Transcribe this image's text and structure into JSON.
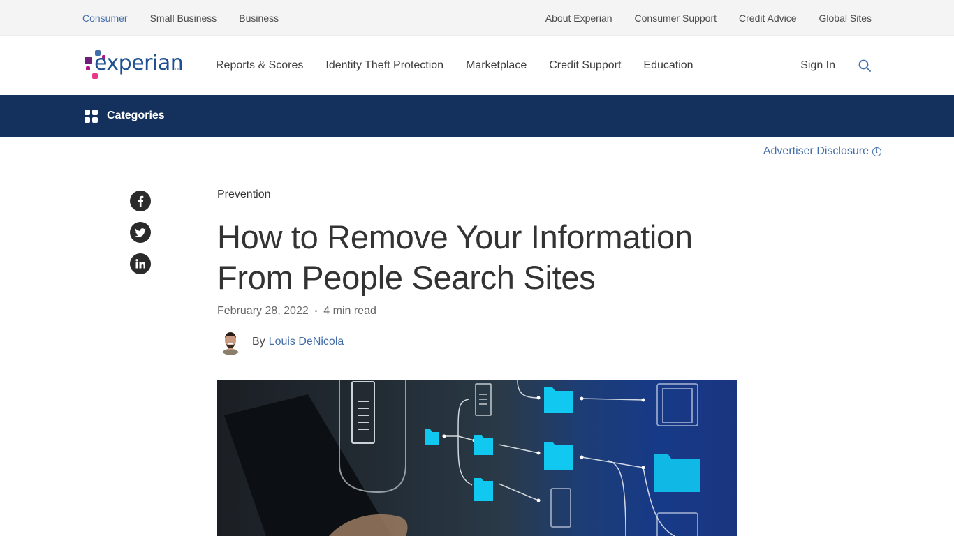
{
  "utility_nav": {
    "left": [
      {
        "label": "Consumer",
        "active": true
      },
      {
        "label": "Small Business",
        "active": false
      },
      {
        "label": "Business",
        "active": false
      }
    ],
    "right": [
      {
        "label": "About Experian"
      },
      {
        "label": "Consumer Support"
      },
      {
        "label": "Credit Advice"
      },
      {
        "label": "Global Sites"
      }
    ]
  },
  "header": {
    "logo_text": "experian",
    "logo_tm": "TM",
    "nav": [
      {
        "label": "Reports & Scores"
      },
      {
        "label": "Identity Theft Protection"
      },
      {
        "label": "Marketplace"
      },
      {
        "label": "Credit Support"
      },
      {
        "label": "Education"
      }
    ],
    "sign_in": "Sign In",
    "search_icon": "search-icon"
  },
  "categories_bar": {
    "label": "Categories",
    "icon": "grid-icon"
  },
  "advertiser_disclosure": {
    "label": "Advertiser Disclosure",
    "icon": "info-icon",
    "icon_glyph": "i"
  },
  "social": [
    {
      "network": "facebook",
      "icon": "facebook-icon"
    },
    {
      "network": "twitter",
      "icon": "twitter-icon"
    },
    {
      "network": "linkedin",
      "icon": "linkedin-icon"
    }
  ],
  "article": {
    "category": "Prevention",
    "title_line1": "How to Remove Your Information",
    "title_line2": "From People Search Sites",
    "date": "February 28, 2022",
    "separator": "•",
    "read_time": "4 min read",
    "by": "By",
    "author": "Louis DeNicola",
    "hero_alt": "Person using laptop with floating digital folder and document icons"
  },
  "colors": {
    "brand_blue": "#1d4f91",
    "link_blue": "#426da9",
    "category_bar": "#13315c",
    "utility_bg": "#f4f4f4",
    "logo_purple": "#6d2077",
    "logo_magenta": "#e63888",
    "logo_light_blue": "#426da9"
  }
}
